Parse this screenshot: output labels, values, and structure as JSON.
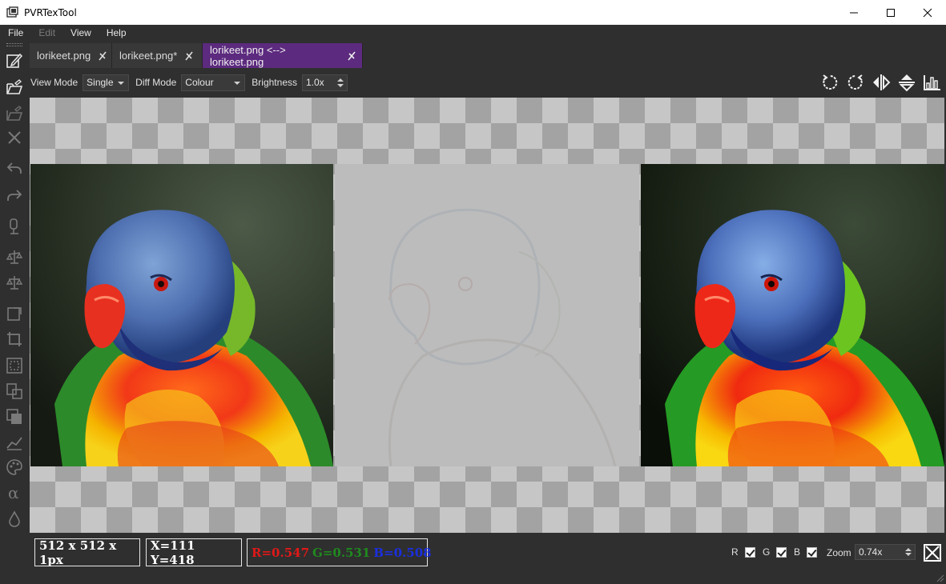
{
  "window": {
    "title": "PVRTexTool"
  },
  "menu": {
    "items": [
      "File",
      "Edit",
      "View",
      "Help"
    ]
  },
  "tabs": [
    {
      "label": "lorikeet.png"
    },
    {
      "label": "lorikeet.png*"
    },
    {
      "label": "lorikeet.png <--> lorikeet.png"
    }
  ],
  "options": {
    "view_mode_label": "View Mode",
    "view_mode_value": "Single",
    "diff_mode_label": "Diff Mode",
    "diff_mode_value": "Colour",
    "brightness_label": "Brightness",
    "brightness_value": "1.0x"
  },
  "status": {
    "dimensions": "512 x 512 x 1px",
    "coords": "X=111 Y=418",
    "r": "R=0.547",
    "g": "G=0.531",
    "b": "B=0.508",
    "channel_r": "R",
    "channel_g": "G",
    "channel_b": "B",
    "zoom_label": "Zoom",
    "zoom_value": "0.74x"
  },
  "colors": {
    "active_tab": "#5c2a7e",
    "background": "#2f2f2f",
    "red_value": "#e01818",
    "green_value": "#1f8a1f",
    "blue_value": "#1a2fe0"
  },
  "icons": {
    "left_toolbar": [
      "edit-icon",
      "open-icon",
      "save-icon",
      "close-icon",
      "undo-icon",
      "redo-icon",
      "encode-icon",
      "resize-icon",
      "balance-icon",
      "crop-icon",
      "border-icon",
      "fit-icon",
      "copy-icon",
      "layers-icon",
      "chart-icon",
      "palette-icon",
      "alpha-icon",
      "drop-icon"
    ],
    "right_toolbar": [
      "rotate-ccw-icon",
      "rotate-cw-icon",
      "flip-horizontal-icon",
      "flip-vertical-icon",
      "histogram-icon"
    ]
  }
}
